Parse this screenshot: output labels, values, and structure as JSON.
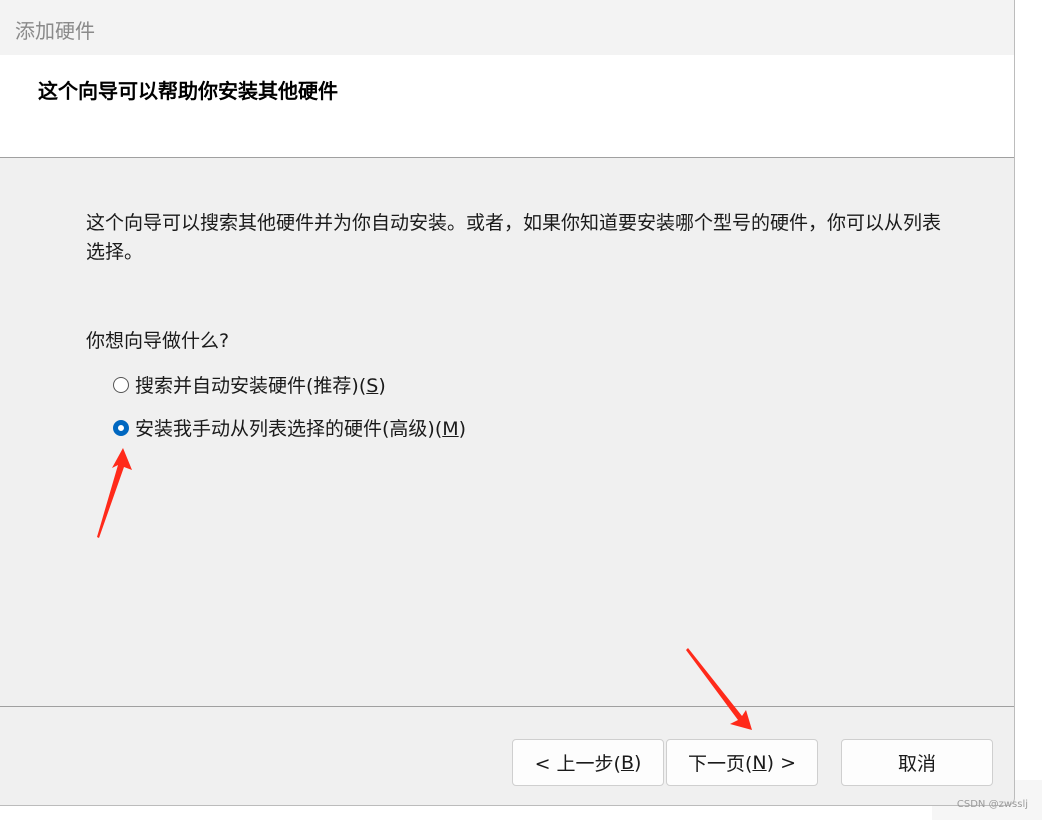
{
  "window": {
    "title": "添加硬件"
  },
  "header": {
    "heading": "这个向导可以帮助你安装其他硬件"
  },
  "content": {
    "description": "这个向导可以搜索其他硬件并为你自动安装。或者，如果你知道要安装哪个型号的硬件，你可以从列表选择。",
    "question": "你想向导做什么?",
    "options": [
      {
        "label_main": "搜索并自动安装硬件(推荐)(",
        "accel": "S",
        "label_end": ")",
        "selected": false
      },
      {
        "label_main": "安装我手动从列表选择的硬件(高级)(",
        "accel": "M",
        "label_end": ")",
        "selected": true
      }
    ]
  },
  "footer": {
    "back": {
      "pre": "< 上一步(",
      "accel": "B",
      "post": ")"
    },
    "next": {
      "pre": "下一页(",
      "accel": "N",
      "post": ") >"
    },
    "cancel": {
      "label": "取消"
    }
  },
  "annotations": {
    "arrow_color": "#ff2a1a"
  },
  "watermark": "CSDN @zwsslj"
}
